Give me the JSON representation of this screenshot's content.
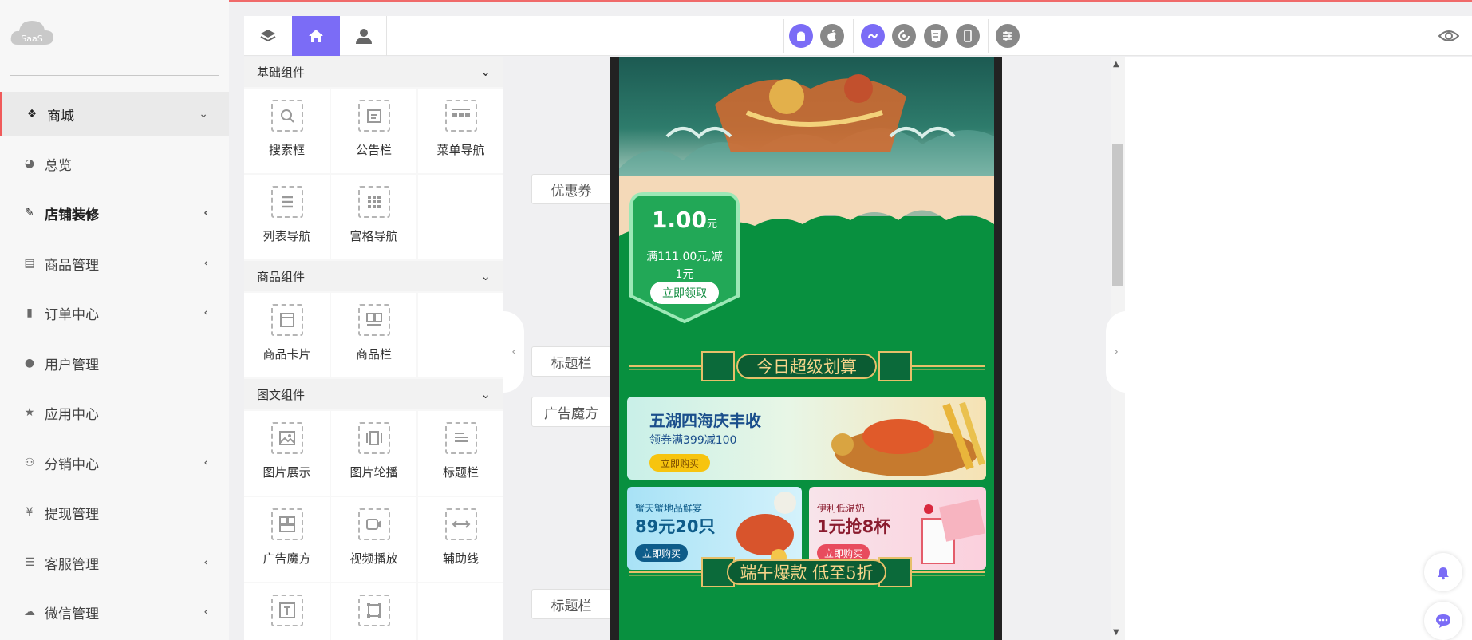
{
  "logo": {
    "text": "SaaS"
  },
  "sidebar": {
    "items": [
      {
        "label": "商城",
        "icon": "dropbox-icon",
        "arrow": "⌄"
      },
      {
        "label": "总览",
        "icon": "pie-chart-icon",
        "arrow": ""
      },
      {
        "label": "店铺装修",
        "icon": "brush-icon",
        "arrow": "‹"
      },
      {
        "label": "商品管理",
        "icon": "archive-box-icon",
        "arrow": "‹"
      },
      {
        "label": "订单中心",
        "icon": "document-icon",
        "arrow": "‹"
      },
      {
        "label": "用户管理",
        "icon": "user-icon",
        "arrow": ""
      },
      {
        "label": "应用中心",
        "icon": "star-icon",
        "arrow": ""
      },
      {
        "label": "分销中心",
        "icon": "users-icon",
        "arrow": "‹"
      },
      {
        "label": "提现管理",
        "icon": "yen-icon",
        "arrow": ""
      },
      {
        "label": "客服管理",
        "icon": "list-icon",
        "arrow": "‹"
      },
      {
        "label": "微信管理",
        "icon": "wechat-icon",
        "arrow": "‹"
      }
    ]
  },
  "toolbar": {
    "tabs": [
      "layers-icon",
      "home-icon",
      "user-icon"
    ],
    "platforms": [
      "android-icon",
      "apple-icon",
      "mini-program-icon",
      "alipay-icon",
      "html5-icon",
      "mobile-icon",
      "settings-sliders-icon"
    ],
    "preview_icon": "eye-icon"
  },
  "panel": {
    "sections": [
      {
        "title": "基础组件",
        "items": [
          "搜索框",
          "公告栏",
          "菜单导航",
          "列表导航",
          "宫格导航"
        ]
      },
      {
        "title": "商品组件",
        "items": [
          "商品卡片",
          "商品栏"
        ]
      },
      {
        "title": "图文组件",
        "items": [
          "图片展示",
          "图片轮播",
          "标题栏",
          "广告魔方",
          "视频播放",
          "辅助线",
          "",
          ""
        ]
      }
    ]
  },
  "canvas": {
    "tags": [
      "优惠券",
      "标题栏",
      "广告魔方",
      "标题栏"
    ],
    "coupon": {
      "amount": "1.00",
      "unit": "元",
      "desc_line1": "满111.00元,减",
      "desc_line2": "1元",
      "button": "立即领取"
    },
    "title1": "今日超级划算",
    "title2": "端午爆款 低至5折",
    "ad1": {
      "title": "五湖四海庆丰收",
      "subtitle": "领券满399减100",
      "button": "立即购买"
    },
    "ad2": {
      "small": "蟹天蟹地品鲜宴",
      "big": "89元20只",
      "button": "立即购买"
    },
    "ad3": {
      "small": "伊利低温奶",
      "big": "1元抢8杯",
      "button": "立即购买"
    }
  },
  "colors": {
    "accent": "#7b6cf6",
    "brand_red": "#f05a5a",
    "screen_green": "#08903f"
  }
}
